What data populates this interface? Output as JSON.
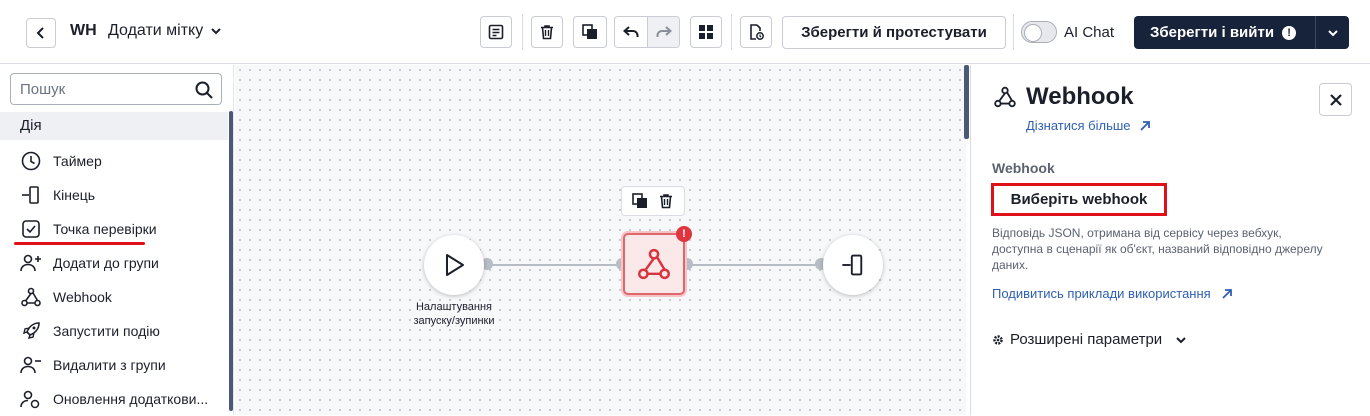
{
  "header": {
    "workflow_abbr": "WH",
    "workflow_name": "Додати мітку",
    "save_test_label": "Зберегти й протестувати",
    "ai_chat_label": "AI Chat",
    "ai_chat_enabled": false,
    "save_exit_label": "Зберегти і вийти",
    "save_exit_warning": "!"
  },
  "sidebar": {
    "search_placeholder": "Пошук",
    "section_label": "Дія",
    "items": [
      {
        "label": "Таймер",
        "icon": "clock-icon"
      },
      {
        "label": "Кінець",
        "icon": "exit-icon"
      },
      {
        "label": "Точка перевірки",
        "icon": "checkpoint-icon"
      },
      {
        "label": "Додати до групи",
        "icon": "add-group-icon"
      },
      {
        "label": "Webhook",
        "icon": "webhook-icon"
      },
      {
        "label": "Запустити подію",
        "icon": "rocket-icon"
      },
      {
        "label": "Видалити з групи",
        "icon": "remove-group-icon"
      },
      {
        "label": "Оновлення додаткови...",
        "icon": "update-user-icon"
      }
    ]
  },
  "canvas": {
    "start_node_label": "Налаштування запуску/зупинки",
    "webhook_badge": "!"
  },
  "panel": {
    "title": "Webhook",
    "learn_more": "Дізнатися більше",
    "section_label": "Webhook",
    "select_button": "Виберіть webhook",
    "description": "Відповідь JSON, отримана від сервісу через вебхук, доступна в сценарії як об'єкт, названий відповідно джерелу даних.",
    "examples_link": "Подивитись приклади використання",
    "advanced_label": "Розширені параметри"
  },
  "colors": {
    "primary_dark": "#17223b",
    "highlight_red": "#e0101b",
    "link_blue": "#2f5fb3",
    "error_badge": "#e0343f"
  }
}
